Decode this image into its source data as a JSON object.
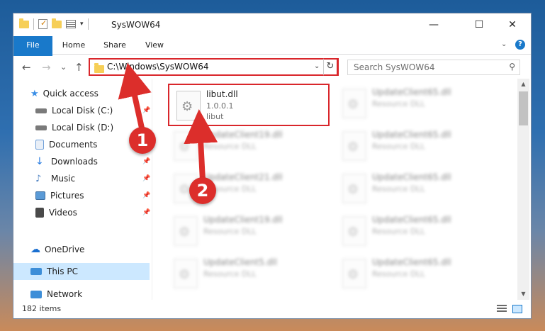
{
  "window": {
    "title": "SysWOW64",
    "controls": {
      "minimize": "—",
      "maximize": "☐",
      "close": "✕"
    }
  },
  "ribbon": {
    "tabs": [
      {
        "label": "File",
        "active": true
      },
      {
        "label": "Home"
      },
      {
        "label": "Share"
      },
      {
        "label": "View"
      }
    ],
    "expand_icon": "chevron-down-icon",
    "help_label": "?"
  },
  "nav": {
    "back": "←",
    "forward": "→",
    "recent": "⌄",
    "up": "↑",
    "address": "C:\\Windows\\SysWOW64",
    "refresh": "↻",
    "search_placeholder": "Search SysWOW64",
    "search_icon": "🔍"
  },
  "sidebar": {
    "items": [
      {
        "label": "Quick access",
        "icon": "star-icon",
        "color": "#3a8ee6"
      },
      {
        "label": "Local Disk (C:)",
        "icon": "drive-icon",
        "color": "#7a7a7a",
        "pinned": true
      },
      {
        "label": "Local Disk (D:)",
        "icon": "drive-icon",
        "color": "#7a7a7a"
      },
      {
        "label": "Documents",
        "icon": "documents-icon",
        "color": "#6f9fd8",
        "pinned": true
      },
      {
        "label": "Downloads",
        "icon": "download-icon",
        "color": "#2a7de1",
        "pinned": true
      },
      {
        "label": "Music",
        "icon": "music-icon",
        "color": "#4a7fc1",
        "pinned": true
      },
      {
        "label": "Pictures",
        "icon": "pictures-icon",
        "color": "#5a9ad6",
        "pinned": true
      },
      {
        "label": "Videos",
        "icon": "videos-icon",
        "color": "#4a4a4a",
        "pinned": true
      },
      {
        "label": "OneDrive",
        "icon": "cloud-icon",
        "color": "#1a6fd0"
      },
      {
        "label": "This PC",
        "icon": "computer-icon",
        "color": "#3d8ed8",
        "selected": true
      },
      {
        "label": "Network",
        "icon": "network-icon",
        "color": "#3d8ed8"
      }
    ],
    "pin_glyph": "📌"
  },
  "files": [
    {
      "name": "libut.dll",
      "line2": "1.0.0.1",
      "line3": "libut",
      "highlighted": true
    },
    {
      "name": "UpdateClient65.dll",
      "line2": "Resource DLL"
    },
    {
      "name": "UpdateClient19.dll",
      "line2": "Resource DLL"
    },
    {
      "name": "UpdateClient65.dll",
      "line2": "Resource DLL"
    },
    {
      "name": "UpdateClient21.dll",
      "line2": "Resource DLL"
    },
    {
      "name": "UpdateClient65.dll",
      "line2": "Resource DLL"
    },
    {
      "name": "UpdateClient19.dll",
      "line2": "Resource DLL"
    },
    {
      "name": "UpdateClient65.dll",
      "line2": "Resource DLL"
    },
    {
      "name": "UpdateClient5.dll",
      "line2": "Resource DLL"
    },
    {
      "name": "UpdateClient65.dll",
      "line2": "Resource DLL"
    }
  ],
  "status": {
    "items_count": "182 items"
  },
  "annotations": [
    {
      "label": "1",
      "color": "#dc2e2b"
    },
    {
      "label": "2",
      "color": "#dc2e2b"
    }
  ],
  "colors": {
    "accent": "#1979ca",
    "highlight": "#d9262b",
    "selected_bg": "#cce8ff"
  }
}
